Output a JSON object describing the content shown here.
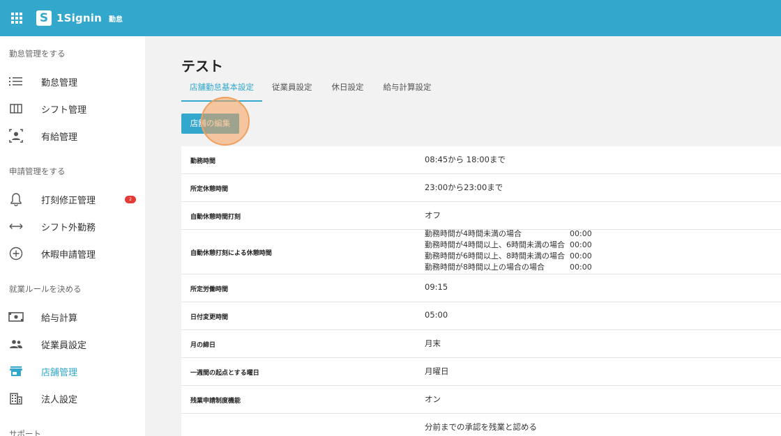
{
  "header": {
    "brand": "1Signin",
    "subtitle": "勤怠"
  },
  "sidebar": {
    "sections": [
      {
        "title": "勤怠管理をする",
        "items": [
          {
            "label": "勤怠管理",
            "icon": "list-icon"
          },
          {
            "label": "シフト管理",
            "icon": "columns-icon"
          },
          {
            "label": "有給管理",
            "icon": "person-box-icon"
          }
        ]
      },
      {
        "title": "申請管理をする",
        "items": [
          {
            "label": "打刻修正管理",
            "icon": "bell-icon",
            "badge": "2"
          },
          {
            "label": "シフト外勤務",
            "icon": "arrows-horizontal-icon"
          },
          {
            "label": "休暇申請管理",
            "icon": "plus-circle-icon"
          }
        ]
      },
      {
        "title": "就業ルールを決める",
        "items": [
          {
            "label": "給与計算",
            "icon": "money-icon"
          },
          {
            "label": "従業員設定",
            "icon": "people-icon"
          },
          {
            "label": "店舗管理",
            "icon": "store-icon",
            "active": true
          },
          {
            "label": "法人設定",
            "icon": "building-icon"
          }
        ]
      },
      {
        "title": "サポート",
        "items": []
      }
    ]
  },
  "main": {
    "title": "テスト",
    "tabs": [
      {
        "label": "店舗勤怠基本設定",
        "active": true
      },
      {
        "label": "従業員設定"
      },
      {
        "label": "休日設定"
      },
      {
        "label": "給与計算設定"
      }
    ],
    "edit_button": "店舗の編集",
    "rows": [
      {
        "key": "勤務時間",
        "value": "08:45から 18:00まで"
      },
      {
        "key": "所定休憩時間",
        "value": "23:00から23:00まで"
      },
      {
        "key": "自動休憩時間打刻",
        "value": "オフ"
      },
      {
        "key": "自動休憩打刻による休憩時間",
        "lines": [
          {
            "text": "勤務時間が4時間未満の場合",
            "time": "00:00"
          },
          {
            "text": "勤務時間が4時間以上、6時間未満の場合",
            "time": "00:00"
          },
          {
            "text": "勤務時間が6時間以上、8時間未満の場合",
            "time": "00:00"
          },
          {
            "text": "勤務時間が8時間以上の場合の場合",
            "time": "00:00"
          }
        ]
      },
      {
        "key": "所定労働時間",
        "value": "09:15"
      },
      {
        "key": "日付変更時間",
        "value": "05:00"
      },
      {
        "key": "月の締日",
        "value": "月末"
      },
      {
        "key": "一週間の起点とする曜日",
        "value": "月曜日"
      },
      {
        "key": "残業申請制度機能",
        "value": "オン"
      },
      {
        "key": "",
        "value": "分前までの承認を残業と認める"
      }
    ]
  }
}
